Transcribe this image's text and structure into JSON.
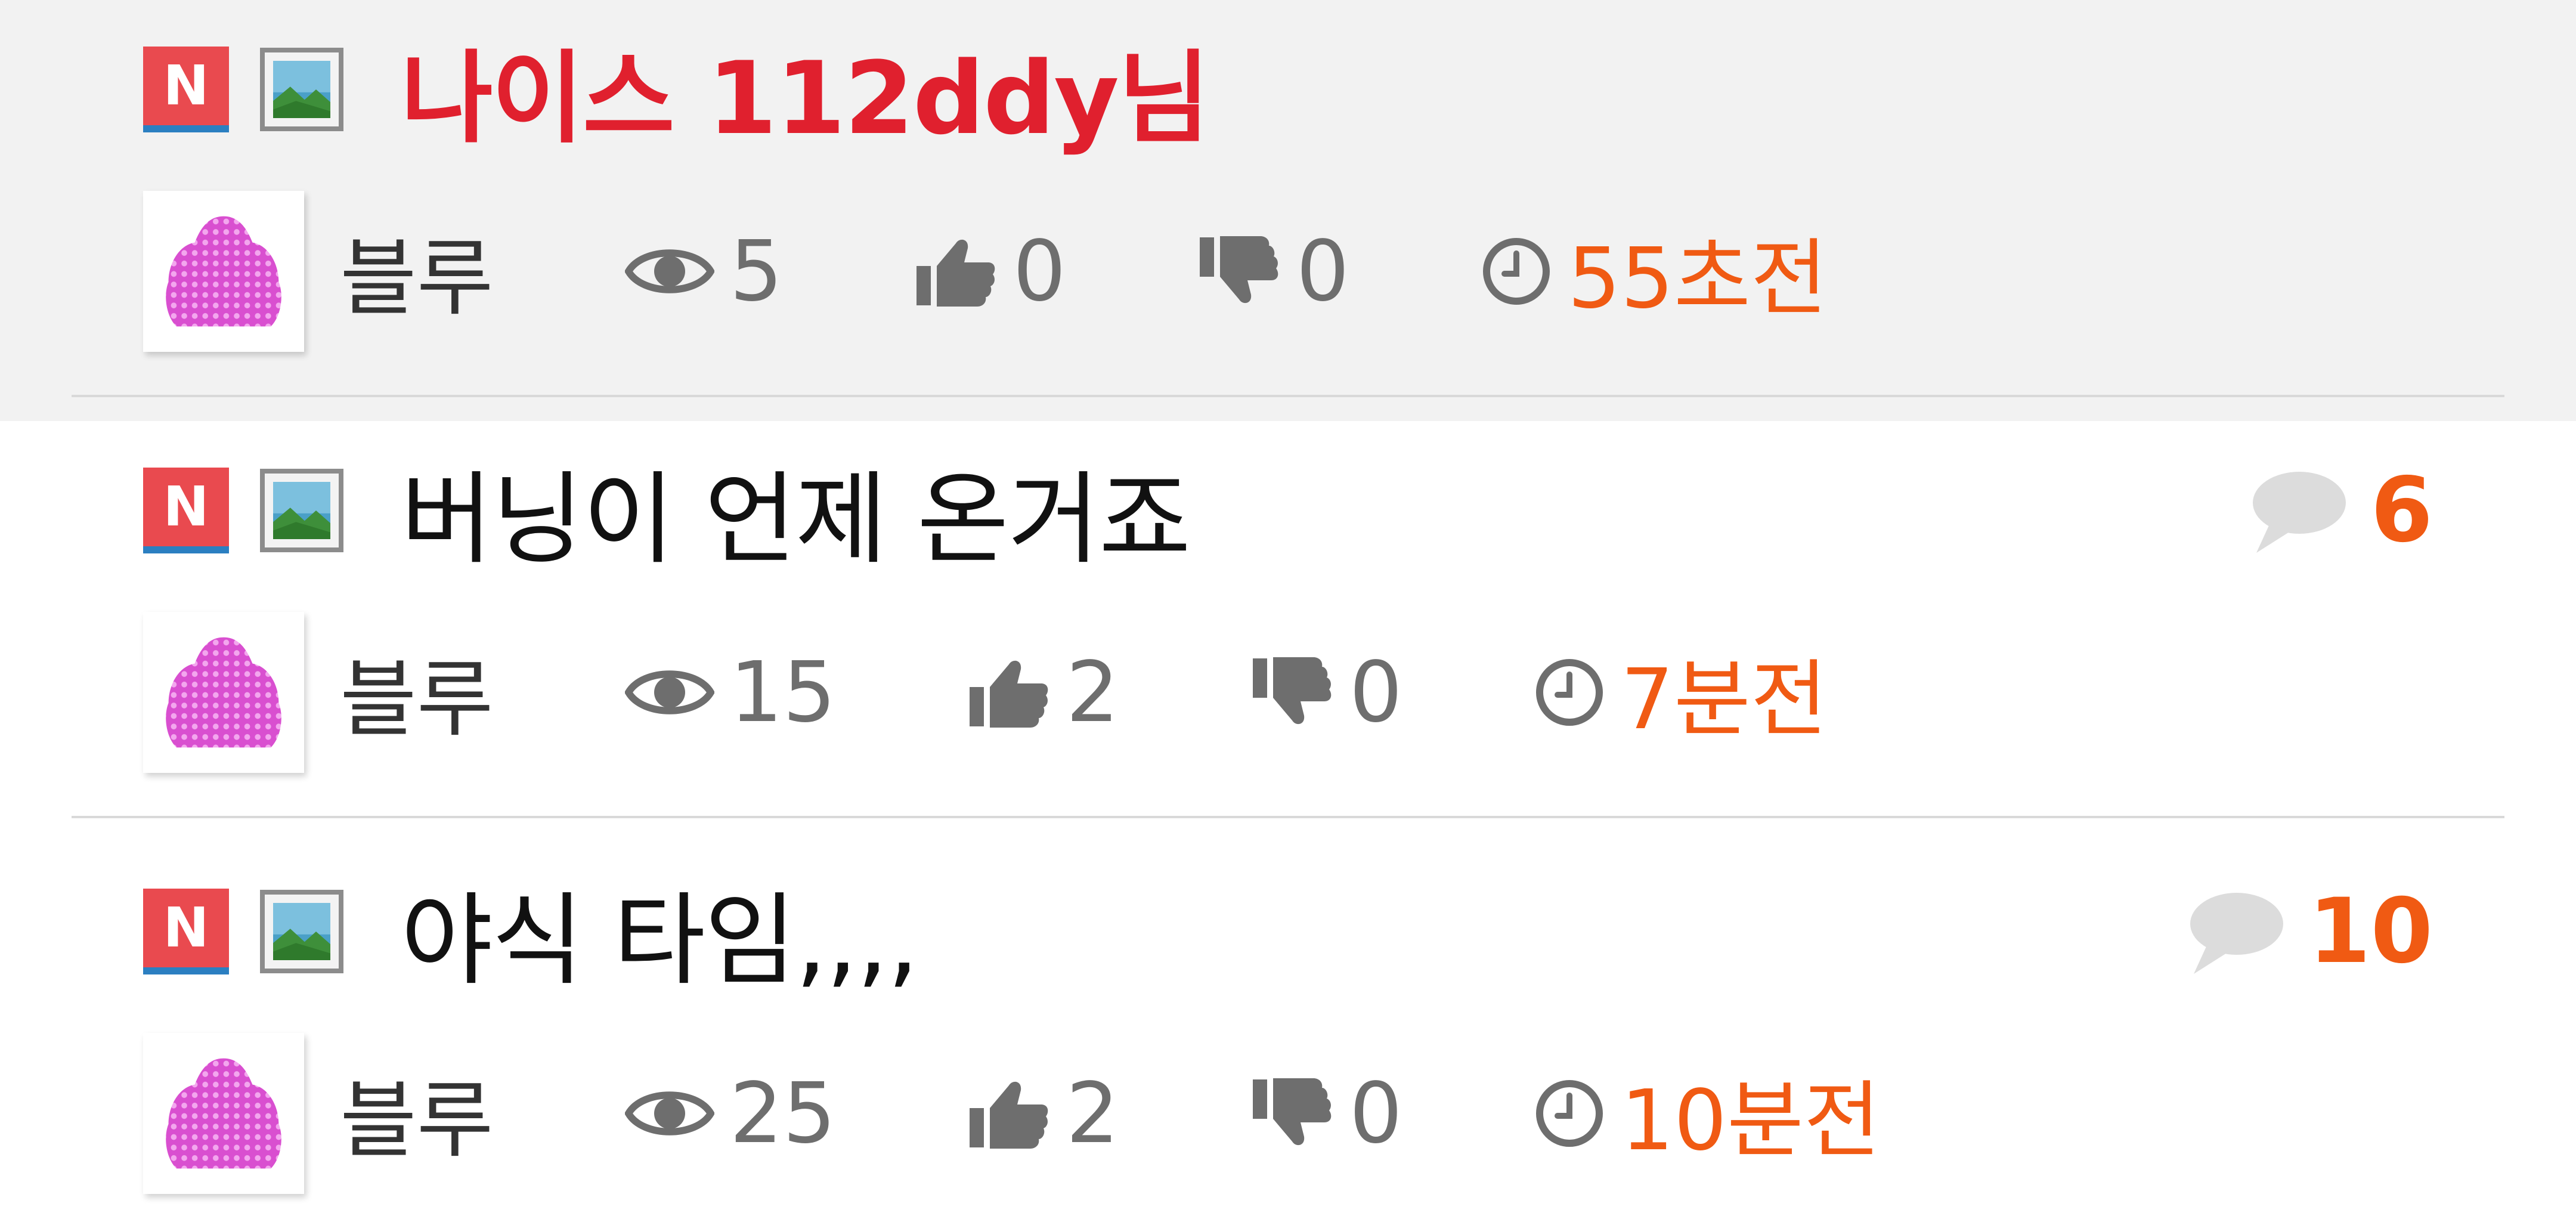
{
  "posts": [
    {
      "badge": "N",
      "title": "나이스 112ddy님",
      "comments": "",
      "author": "블루",
      "views": "5",
      "likes": "0",
      "dislikes": "0",
      "time": "55초전"
    },
    {
      "badge": "N",
      "title": "버닝이 언제 온거죠",
      "comments": "6",
      "author": "블루",
      "views": "15",
      "likes": "2",
      "dislikes": "0",
      "time": "7분전"
    },
    {
      "badge": "N",
      "title": "야식 타임,,,,",
      "comments": "10",
      "author": "블루",
      "views": "25",
      "likes": "2",
      "dislikes": "0",
      "time": "10분전"
    }
  ],
  "colors": {
    "hot_title": "#e0202e",
    "accent": "#f05a13",
    "meta": "#6e6e6e",
    "highlight_bg": "#f2f2f2"
  },
  "icons": {
    "new": "new-badge-icon",
    "image": "image-attachment-icon",
    "comment": "speech-bubble-icon",
    "views": "eye-icon",
    "likes": "thumbs-up-icon",
    "dislikes": "thumbs-down-icon",
    "time": "clock-icon"
  }
}
